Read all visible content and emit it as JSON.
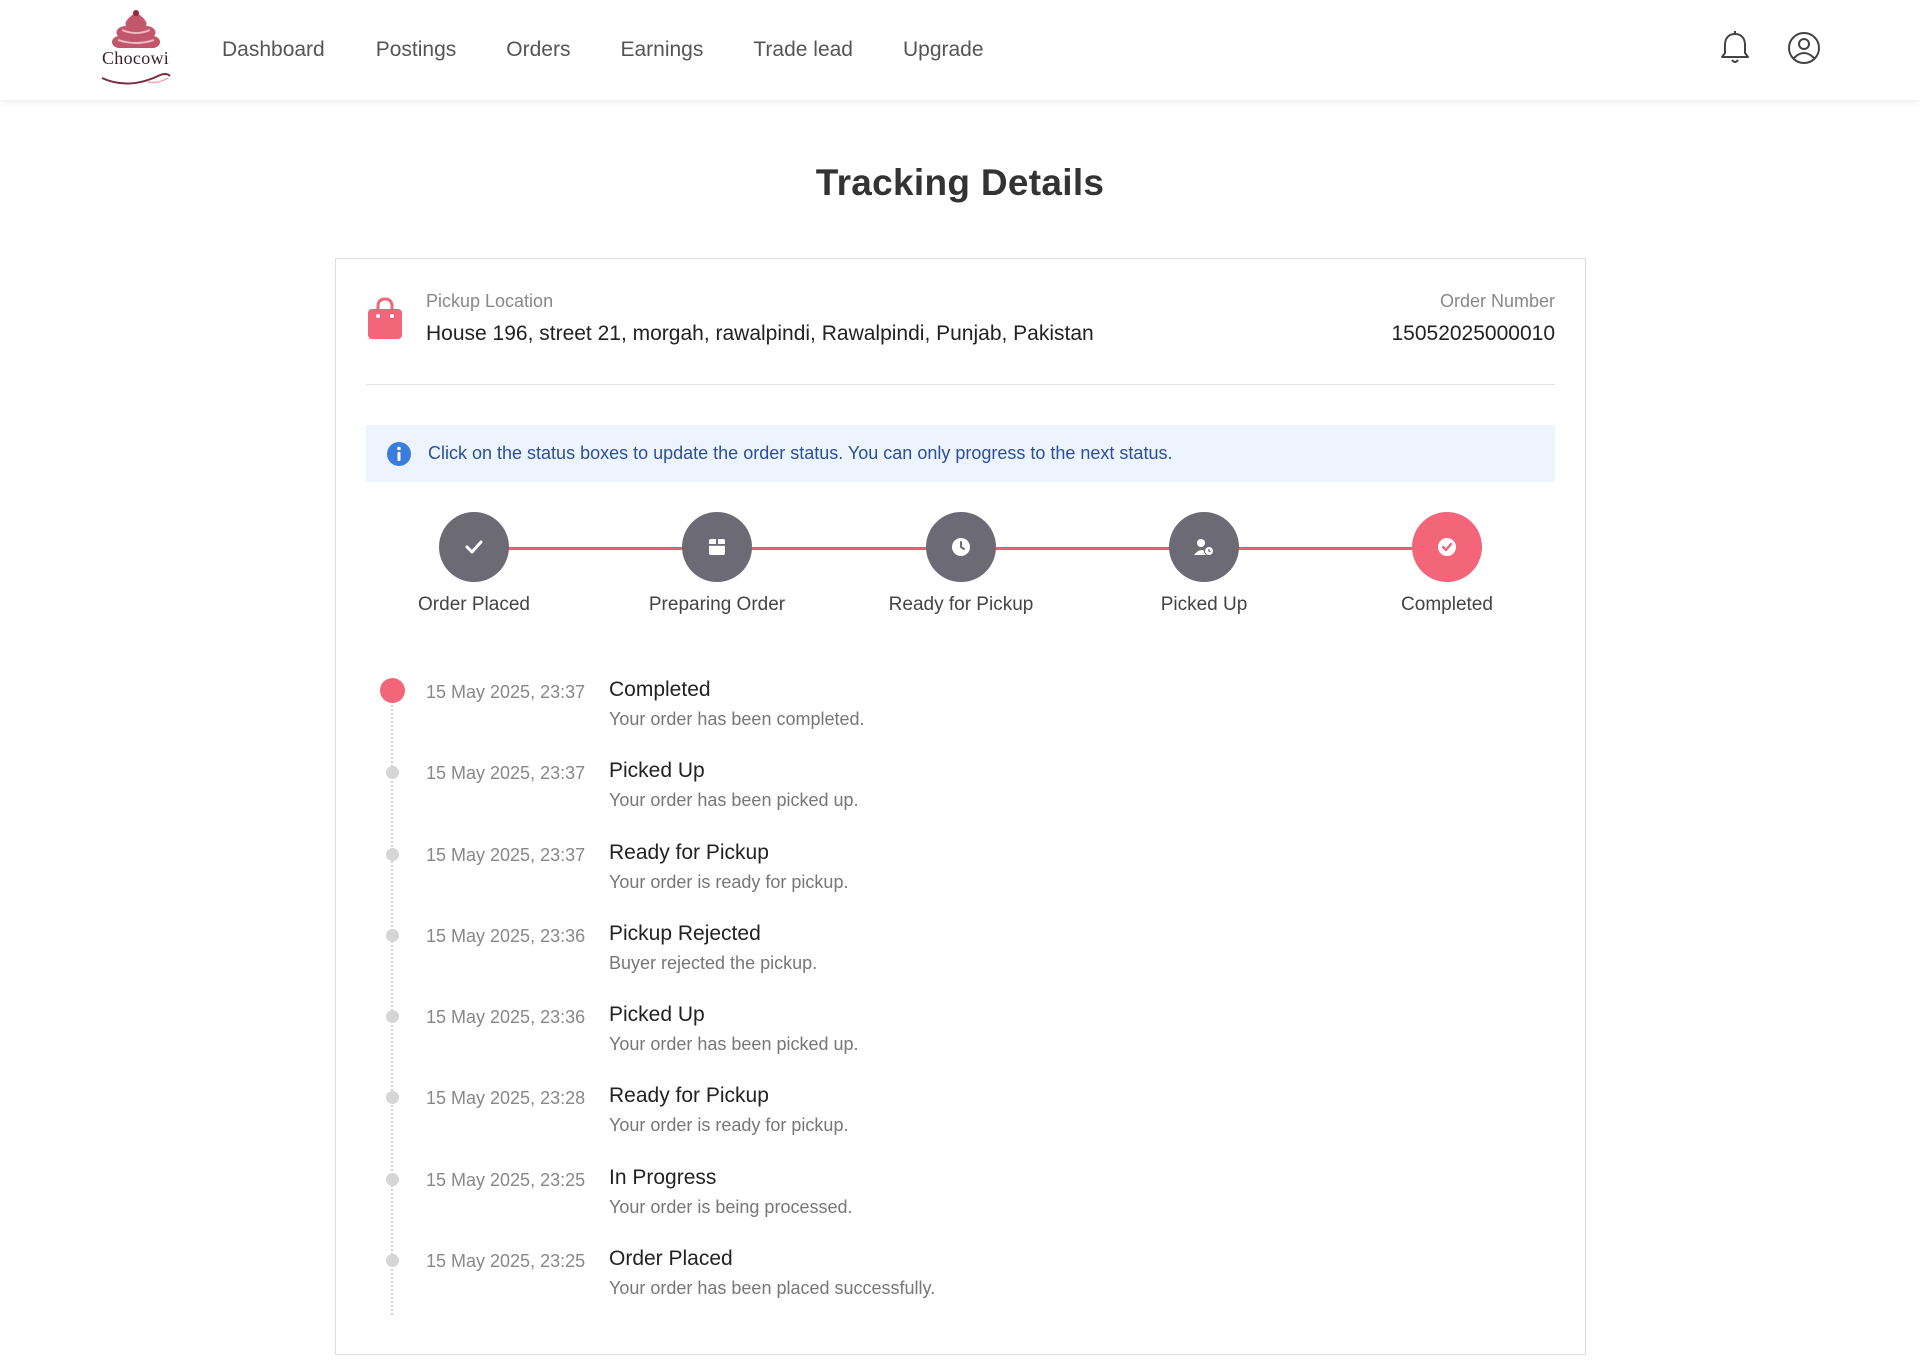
{
  "brand": {
    "name": "Chocowi",
    "accent": "#f36679"
  },
  "nav": {
    "items": [
      "Dashboard",
      "Postings",
      "Orders",
      "Earnings",
      "Trade lead",
      "Upgrade"
    ]
  },
  "header_icons": [
    "bell-icon",
    "user-circle-icon"
  ],
  "page": {
    "title": "Tracking Details"
  },
  "pickup": {
    "label": "Pickup Location",
    "address": "House 196, street 21, morgah, rawalpindi, Rawalpindi, Punjab, Pakistan"
  },
  "order": {
    "label": "Order Number",
    "number": "15052025000010"
  },
  "info": {
    "text": "Click on the status boxes to update the order status. You can only progress to the next status."
  },
  "steps": [
    {
      "label": "Order Placed",
      "icon": "check-icon"
    },
    {
      "label": "Preparing Order",
      "icon": "box-icon"
    },
    {
      "label": "Ready for Pickup",
      "icon": "clock-icon"
    },
    {
      "label": "Picked Up",
      "icon": "user-clock-icon"
    },
    {
      "label": "Completed",
      "icon": "check-circle-icon",
      "active": true
    }
  ],
  "timeline": [
    {
      "date": "15 May 2025, 23:37",
      "title": "Completed",
      "desc": "Your order has been completed.",
      "active": true
    },
    {
      "date": "15 May 2025, 23:37",
      "title": "Picked Up",
      "desc": "Your order has been picked up."
    },
    {
      "date": "15 May 2025, 23:37",
      "title": "Ready for Pickup",
      "desc": "Your order is ready for pickup."
    },
    {
      "date": "15 May 2025, 23:36",
      "title": "Pickup Rejected",
      "desc": "Buyer rejected the pickup."
    },
    {
      "date": "15 May 2025, 23:36",
      "title": "Picked Up",
      "desc": "Your order has been picked up."
    },
    {
      "date": "15 May 2025, 23:28",
      "title": "Ready for Pickup",
      "desc": "Your order is ready for pickup."
    },
    {
      "date": "15 May 2025, 23:25",
      "title": "In Progress",
      "desc": "Your order is being processed."
    },
    {
      "date": "15 May 2025, 23:25",
      "title": "Order Placed",
      "desc": "Your order has been placed successfully."
    }
  ]
}
